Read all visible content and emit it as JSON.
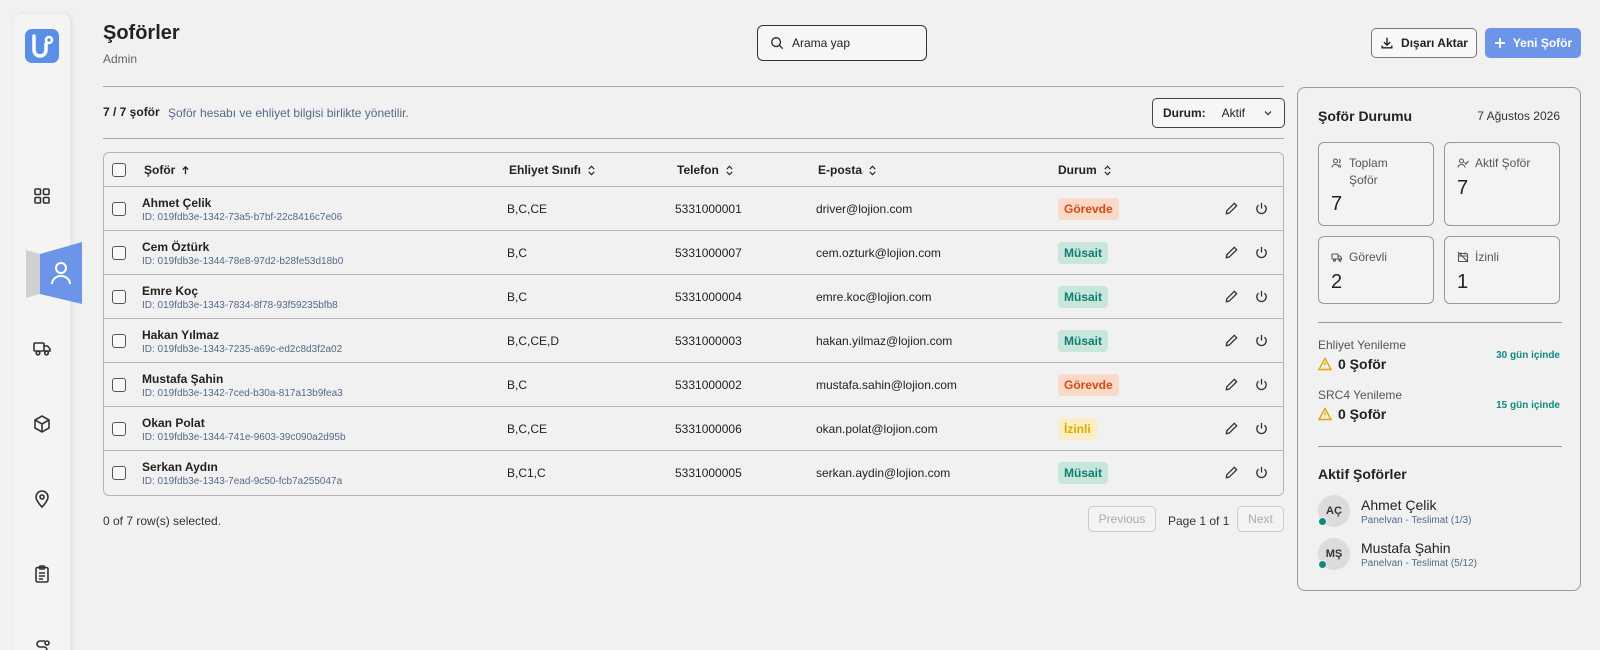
{
  "header": {
    "title": "Şoförler",
    "subtitle": "Admin",
    "search_placeholder": "Arama yap",
    "export_label": "Dışarı Aktar",
    "new_label": "Yeni Şoför"
  },
  "summary": {
    "count": "7 / 7 şoför",
    "description": "Şoför hesabı ve ehliyet bilgisi birlikte yönetilir.",
    "filter_label": "Durum:",
    "filter_value": "Aktif"
  },
  "table": {
    "columns": {
      "driver": "Şoför",
      "license": "Ehliyet Sınıfı",
      "phone": "Telefon",
      "email": "E-posta",
      "status": "Durum"
    },
    "rows": [
      {
        "name": "Ahmet Çelik",
        "id": "ID: 019fdb3e-1342-73a5-b7bf-22c8416c7e06",
        "license": "B,C,CE",
        "phone": "5331000001",
        "email": "driver@lojion.com",
        "status": "Görevde"
      },
      {
        "name": "Cem Öztürk",
        "id": "ID: 019fdb3e-1344-78e8-97d2-b28fe53d18b0",
        "license": "B,C",
        "phone": "5331000007",
        "email": "cem.ozturk@lojion.com",
        "status": "Müsait"
      },
      {
        "name": "Emre Koç",
        "id": "ID: 019fdb3e-1343-7834-8f78-93f59235bfb8",
        "license": "B,C",
        "phone": "5331000004",
        "email": "emre.koc@lojion.com",
        "status": "Müsait"
      },
      {
        "name": "Hakan Yılmaz",
        "id": "ID: 019fdb3e-1343-7235-a69c-ed2c8d3f2a02",
        "license": "B,C,CE,D",
        "phone": "5331000003",
        "email": "hakan.yilmaz@lojion.com",
        "status": "Müsait"
      },
      {
        "name": "Mustafa Şahin",
        "id": "ID: 019fdb3e-1342-7ced-b30a-817a13b9fea3",
        "license": "B,C",
        "phone": "5331000002",
        "email": "mustafa.sahin@lojion.com",
        "status": "Görevde"
      },
      {
        "name": "Okan Polat",
        "id": "ID: 019fdb3e-1344-741e-9603-39c090a2d95b",
        "license": "B,C,CE",
        "phone": "5331000006",
        "email": "okan.polat@lojion.com",
        "status": "İzinli"
      },
      {
        "name": "Serkan Aydın",
        "id": "ID: 019fdb3e-1343-7ead-9c50-fcb7a255047a",
        "license": "B,C1,C",
        "phone": "5331000005",
        "email": "serkan.aydin@lojion.com",
        "status": "Müsait"
      }
    ]
  },
  "footer": {
    "selected": "0 of 7 row(s) selected.",
    "previous": "Previous",
    "page_info": "Page 1 of 1",
    "next": "Next"
  },
  "panel": {
    "title": "Şoför Durumu",
    "date": "7 Ağustos 2026",
    "stats": [
      {
        "label": "Toplam Şoför",
        "value": "7",
        "icon": "users-icon"
      },
      {
        "label": "Aktif Şoför",
        "value": "7",
        "icon": "user-check-icon"
      },
      {
        "label": "Görevli",
        "value": "2",
        "icon": "truck-icon"
      },
      {
        "label": "İzinli",
        "value": "1",
        "icon": "calendar-off-icon"
      }
    ],
    "renewals": [
      {
        "label": "Ehliyet Yenileme",
        "value": "0 Şoför",
        "days": "30 gün içinde"
      },
      {
        "label": "SRC4 Yenileme",
        "value": "0 Şoför",
        "days": "15 gün içinde"
      }
    ],
    "active_title": "Aktif Şoförler",
    "active_drivers": [
      {
        "initials": "AÇ",
        "name": "Ahmet Çelik",
        "detail": "Panelvan - Teslimat (1/3)"
      },
      {
        "initials": "MŞ",
        "name": "Mustafa Şahin",
        "detail": "Panelvan - Teslimat (5/12)"
      }
    ]
  },
  "colors": {
    "accent": "#6c94e8",
    "busy": "#d9480f",
    "available": "#0f8070",
    "leave": "#e0a800"
  }
}
